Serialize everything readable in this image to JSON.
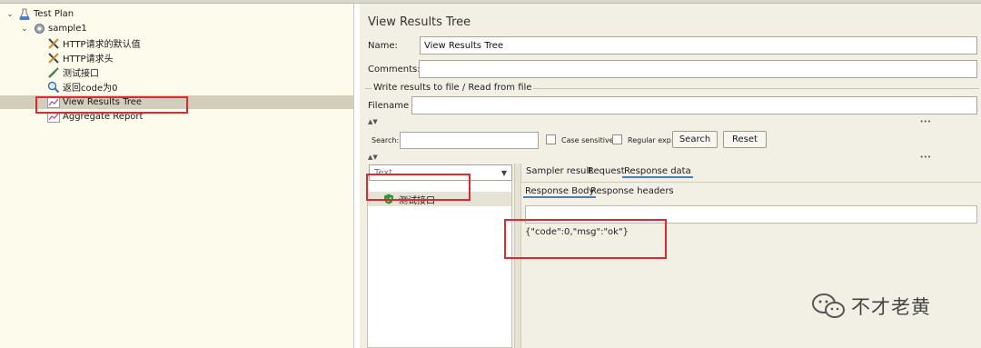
{
  "tree": {
    "root": "Test Plan",
    "thread_group": "sample1",
    "items": [
      {
        "label": "HTTP请求的默认值",
        "icon": "wrench-scissors-icon"
      },
      {
        "label": "HTTP请求头",
        "icon": "wrench-scissors-icon"
      },
      {
        "label": "测试接口",
        "icon": "pipette-icon"
      },
      {
        "label": "返回code为0",
        "icon": "magnifier-icon"
      },
      {
        "label": "View Results Tree",
        "icon": "graph-icon",
        "selected": true
      },
      {
        "label": "Aggregate Report",
        "icon": "graph-icon"
      }
    ]
  },
  "panel": {
    "title": "View Results Tree",
    "name_label": "Name:",
    "name_value": "View Results Tree",
    "comments_label": "Comments:",
    "comments_value": "",
    "file_section": "Write results to file / Read from file",
    "filename_label": "Filename",
    "filename_value": ""
  },
  "search": {
    "label": "Search:",
    "value": "",
    "case_sensitive": "Case sensitive",
    "regex": "Regular exp.",
    "search_button": "Search",
    "reset_button": "Reset"
  },
  "results": {
    "renderer": "Text",
    "entries": [
      {
        "label": "测试接口",
        "status": "success"
      }
    ]
  },
  "tabs": {
    "main": [
      "Sampler result",
      "Request",
      "Response data"
    ],
    "active_main": "Response data",
    "sub": [
      "Response Body",
      "Response headers"
    ],
    "active_sub": "Response Body"
  },
  "response_body": "{\"code\":0,\"msg\":\"ok\"}",
  "watermark": "不才老黄",
  "colors": {
    "highlight_box": "#e0282f",
    "success": "#2d9a3a",
    "tab_underline": "#4f7eb5"
  }
}
